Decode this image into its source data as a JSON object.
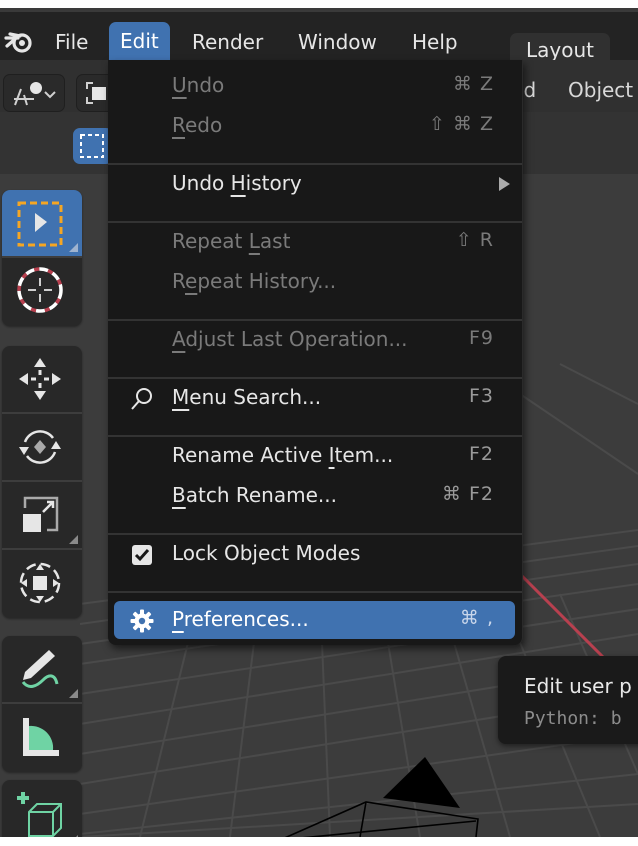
{
  "topbar": {
    "menus": [
      "File",
      "Edit",
      "Render",
      "Window",
      "Help"
    ],
    "active_menu": "Edit",
    "workspace_tab": "Layout"
  },
  "header": {
    "partial_menu_left": "ld",
    "partial_menu_right": "Object"
  },
  "toolbar": {
    "tools": [
      {
        "name": "Select Box",
        "icon": "select-box-icon",
        "active": true
      },
      {
        "name": "Cursor",
        "icon": "cursor-icon"
      },
      {
        "name": "Move",
        "icon": "move-icon"
      },
      {
        "name": "Rotate",
        "icon": "rotate-icon"
      },
      {
        "name": "Scale",
        "icon": "scale-icon"
      },
      {
        "name": "Transform",
        "icon": "transform-icon"
      },
      {
        "name": "Annotate",
        "icon": "annotate-icon"
      },
      {
        "name": "Measure",
        "icon": "measure-icon"
      },
      {
        "name": "Add Cube",
        "icon": "add-cube-icon"
      }
    ]
  },
  "edit_menu": {
    "items": [
      {
        "label_pre": "",
        "label_ul": "U",
        "label_post": "ndo",
        "shortcut": "⌘ Z",
        "disabled": true
      },
      {
        "label_pre": "",
        "label_ul": "R",
        "label_post": "edo",
        "shortcut": "⇧ ⌘ Z",
        "disabled": true
      },
      {
        "label_pre": "Undo ",
        "label_ul": "H",
        "label_post": "istory",
        "shortcut": "",
        "submenu": true
      },
      {
        "label_pre": "Repeat ",
        "label_ul": "L",
        "label_post": "ast",
        "shortcut": "⇧ R",
        "disabled": true
      },
      {
        "label_pre": "R",
        "label_ul": "e",
        "label_post": "peat History...",
        "shortcut": "",
        "disabled": true
      },
      {
        "label_pre": "",
        "label_ul": "A",
        "label_post": "djust Last Operation...",
        "shortcut": "F9",
        "disabled": true
      },
      {
        "label_pre": "",
        "label_ul": "M",
        "label_post": "enu Search...",
        "shortcut": "F3",
        "icon": "search-icon"
      },
      {
        "label_pre": "Rename Active ",
        "label_ul": "I",
        "label_post": "tem...",
        "shortcut": "F2"
      },
      {
        "label_pre": "",
        "label_ul": "B",
        "label_post": "atch Rename...",
        "shortcut": "⌘ F2"
      },
      {
        "label_pre": "Lock Object Modes",
        "label_ul": "",
        "label_post": "",
        "shortcut": "",
        "checkbox": true,
        "checked": true
      },
      {
        "label_pre": "",
        "label_ul": "P",
        "label_post": "references...",
        "shortcut": "⌘ ,",
        "icon": "gear-icon",
        "highlighted": true
      }
    ]
  },
  "tooltip": {
    "title": "Edit user p",
    "python": "Python: b"
  },
  "colors": {
    "accent": "#4072b0",
    "menu_bg": "#181818",
    "x_axis": "#b8404f",
    "tool_green": "#6fd3a4",
    "select_orange": "#f5a623"
  }
}
